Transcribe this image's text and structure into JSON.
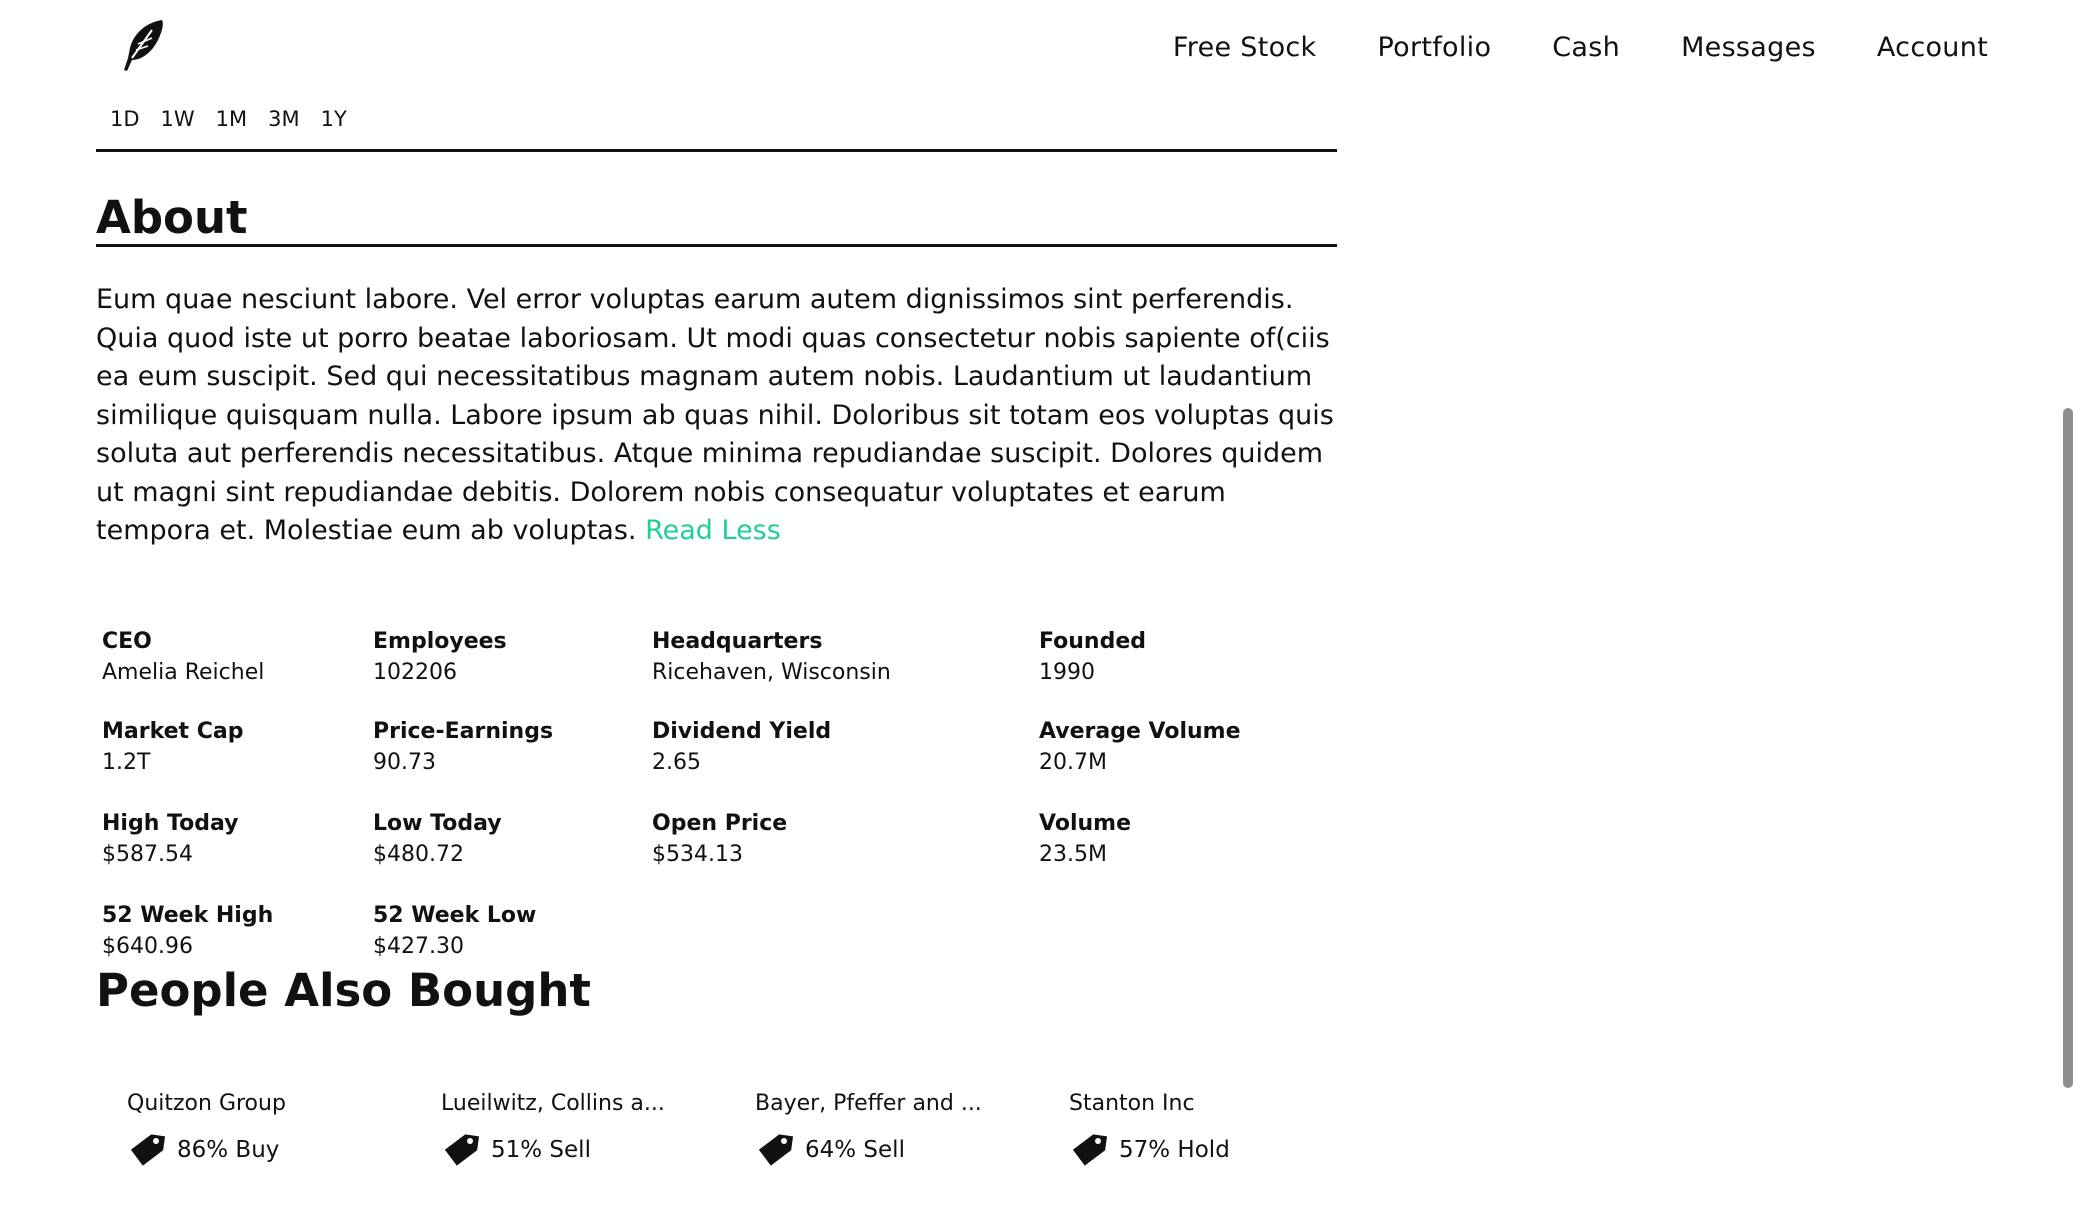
{
  "header": {
    "logo": "feather-logo-icon",
    "nav": [
      "Free Stock",
      "Portfolio",
      "Cash",
      "Messages",
      "Account"
    ]
  },
  "chart": {
    "ranges": [
      "1D",
      "1W",
      "1M",
      "3M",
      "1Y"
    ]
  },
  "about": {
    "title": "About",
    "text": "Eum quae nesciunt labore. Vel error voluptas earum autem dignissimos sint perferendis. Quia quod iste ut porro beatae laboriosam. Ut modi quas consectetur nobis sapiente of(ciis ea eum suscipit. Sed qui necessitatibus magnam autem nobis. Laudantium ut laudantium similique quisquam nulla. Labore ipsum ab quas nihil. Doloribus sit totam eos voluptas quis soluta aut perferendis necessitatibus. Atque minima repudiandae suscipit. Dolores quidem ut magni sint repudiandae debitis. Dolorem nobis consequatur voluptates et earum tempora et. Molestiae eum ab voluptas.",
    "read_less": "Read Less",
    "link_color": "#21ce99"
  },
  "stats": [
    {
      "label": "CEO",
      "value": "Amelia Reichel"
    },
    {
      "label": "Employees",
      "value": "102206"
    },
    {
      "label": "Headquarters",
      "value": "Ricehaven, Wisconsin"
    },
    {
      "label": "Founded",
      "value": "1990"
    },
    {
      "label": "Market Cap",
      "value": "1.2T"
    },
    {
      "label": "Price-Earnings",
      "value": "90.73"
    },
    {
      "label": "Dividend Yield",
      "value": "2.65"
    },
    {
      "label": "Average Volume",
      "value": "20.7M"
    },
    {
      "label": "High Today",
      "value": "$587.54"
    },
    {
      "label": "Low Today",
      "value": "$480.72"
    },
    {
      "label": "Open Price",
      "value": "$534.13"
    },
    {
      "label": "Volume",
      "value": "23.5M"
    },
    {
      "label": "52 Week High",
      "value": "$640.96"
    },
    {
      "label": "52 Week Low",
      "value": "$427.30"
    }
  ],
  "people_also_bought": {
    "title": "People Also Bought",
    "items": [
      {
        "name": "Quitzon Group",
        "rating": "86% Buy",
        "icon": "price-tag-icon"
      },
      {
        "name": "Lueilwitz, Collins a...",
        "rating": "51% Sell",
        "icon": "price-tag-icon"
      },
      {
        "name": "Bayer, Pfeffer and ...",
        "rating": "64% Sell",
        "icon": "price-tag-icon"
      },
      {
        "name": "Stanton Inc",
        "rating": "57% Hold",
        "icon": "price-tag-icon"
      }
    ]
  }
}
